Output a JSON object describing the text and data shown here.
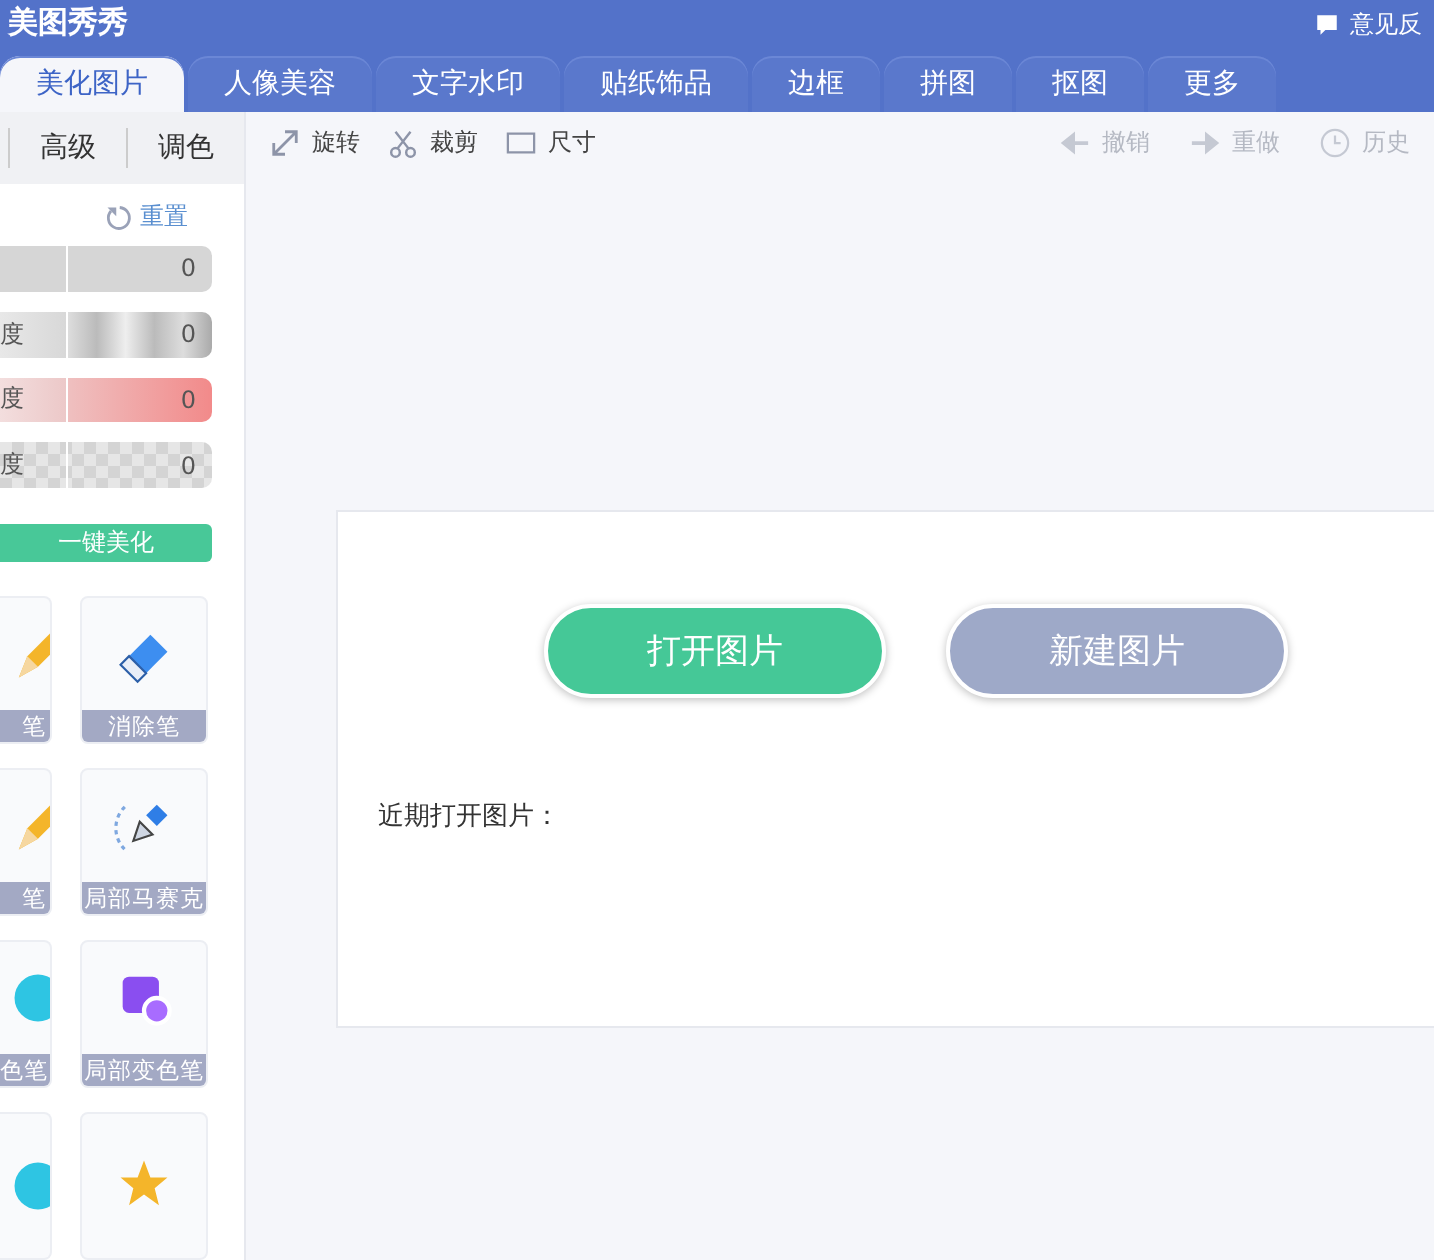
{
  "app_title": "美图秀秀",
  "feedback": "意见反",
  "tabs": [
    {
      "label": "美化图片",
      "selected": true
    },
    {
      "label": "人像美容",
      "selected": false
    },
    {
      "label": "文字水印",
      "selected": false
    },
    {
      "label": "贴纸饰品",
      "selected": false
    },
    {
      "label": "边框",
      "selected": false
    },
    {
      "label": "拼图",
      "selected": false
    },
    {
      "label": "抠图",
      "selected": false
    },
    {
      "label": "更多",
      "selected": false
    }
  ],
  "sidebar": {
    "tabs": [
      {
        "label": "高级",
        "selected": false
      },
      {
        "label": "调色",
        "selected": false
      }
    ],
    "reset": "重置",
    "sliders": [
      {
        "kind": "plain",
        "value": "0"
      },
      {
        "kind": "metal",
        "label": "度",
        "value": "0"
      },
      {
        "kind": "red",
        "label": "度",
        "value": "0"
      },
      {
        "kind": "checker",
        "label": "度",
        "value": "0"
      }
    ],
    "auto_button": "一键美化",
    "tools": [
      {
        "label": "笔"
      },
      {
        "label": "消除笔"
      },
      {
        "label": "笔"
      },
      {
        "label": "局部马赛克"
      },
      {
        "label": "色笔"
      },
      {
        "label": "局部变色笔"
      }
    ]
  },
  "toolbar": [
    {
      "kind": "rotate",
      "label": "旋转",
      "disabled": false
    },
    {
      "kind": "crop",
      "label": "裁剪",
      "disabled": false
    },
    {
      "kind": "size",
      "label": "尺寸",
      "disabled": false
    },
    {
      "kind": "undo",
      "label": "撤销",
      "disabled": true
    },
    {
      "kind": "redo",
      "label": "重做",
      "disabled": true
    },
    {
      "kind": "history",
      "label": "历史",
      "disabled": true
    }
  ],
  "start": {
    "open_button": "打开图片",
    "new_button": "新建图片",
    "recent_label": "近期打开图片："
  }
}
